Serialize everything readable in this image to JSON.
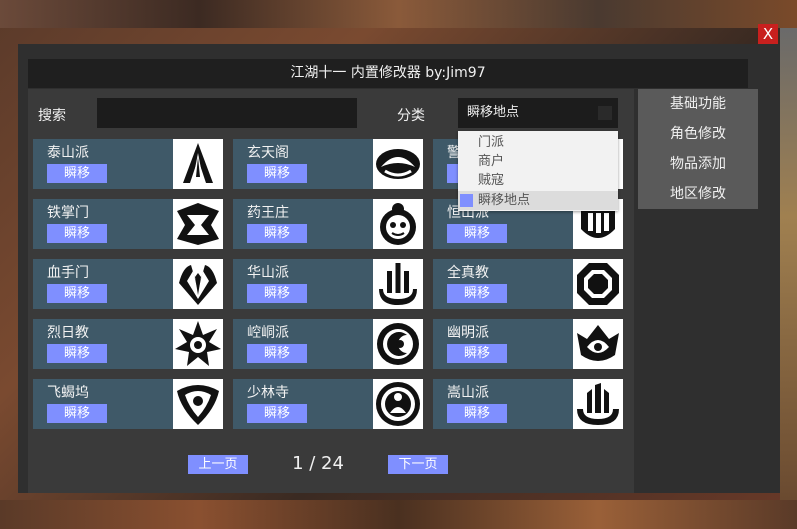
{
  "window": {
    "title": "江湖十一 内置修改器 by:Jim97",
    "close_label": "X"
  },
  "search": {
    "label": "搜索",
    "value": "",
    "placeholder": ""
  },
  "category": {
    "label": "分类",
    "selected": "瞬移地点",
    "options": [
      "门派",
      "商户",
      "贼寇",
      "瞬移地点"
    ]
  },
  "teleport_label": "瞬移",
  "locations": [
    {
      "name": "泰山派",
      "icon": "taishan-emblem-icon"
    },
    {
      "name": "玄天阁",
      "icon": "xuantian-emblem-icon"
    },
    {
      "name": "警",
      "icon": "partial-emblem-icon"
    },
    {
      "name": "铁掌门",
      "icon": "tiezhang-emblem-icon"
    },
    {
      "name": "药王庄",
      "icon": "yaowang-emblem-icon"
    },
    {
      "name": "恒山派",
      "icon": "hengshan-emblem-icon"
    },
    {
      "name": "血手门",
      "icon": "xueshou-emblem-icon"
    },
    {
      "name": "华山派",
      "icon": "huashan-emblem-icon"
    },
    {
      "name": "全真教",
      "icon": "quanzhen-emblem-icon"
    },
    {
      "name": "烈日教",
      "icon": "lieri-emblem-icon"
    },
    {
      "name": "崆峒派",
      "icon": "kongtong-emblem-icon"
    },
    {
      "name": "幽明派",
      "icon": "youming-emblem-icon"
    },
    {
      "name": "飞蝎坞",
      "icon": "feixie-emblem-icon"
    },
    {
      "name": "少林寺",
      "icon": "shaolin-emblem-icon"
    },
    {
      "name": "嵩山派",
      "icon": "songshan-emblem-icon"
    }
  ],
  "sidebar": {
    "items": [
      {
        "label": "基础功能"
      },
      {
        "label": "角色修改"
      },
      {
        "label": "物品添加"
      },
      {
        "label": "地区修改"
      }
    ]
  },
  "pagination": {
    "prev_label": "上一页",
    "next_label": "下一页",
    "indicator": "1 / 24"
  },
  "colors": {
    "accent": "#7f8fff",
    "card_bg": "#3f5968",
    "close": "#c8201e",
    "panel": "#3a3a3a",
    "sidebar": "#5a5a5a"
  }
}
